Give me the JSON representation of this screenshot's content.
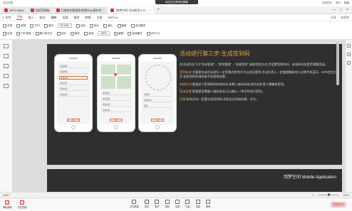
{
  "meeting": {
    "banner": "你正在共享你的屏幕",
    "top_left": "会议详情",
    "top_right": [
      "在线时长",
      "显示",
      "隐藏"
    ],
    "bottom_left": [
      {
        "label": "解除静音",
        "icon": "mic-off-icon"
      },
      {
        "label": "开启视频",
        "icon": "camera-off-icon"
      }
    ],
    "bottom_center": [
      {
        "label": "共享屏幕",
        "icon": "screen-share-icon"
      },
      {
        "label": "成员",
        "icon": "members-icon"
      },
      {
        "label": "聊天",
        "icon": "chat-icon"
      },
      {
        "label": "录制",
        "icon": "record-icon"
      },
      {
        "label": "应用",
        "icon": "apps-icon"
      },
      {
        "label": "白板",
        "icon": "whiteboard-icon"
      },
      {
        "label": "设置",
        "icon": "settings-icon"
      },
      {
        "label": "更多",
        "icon": "more-icon"
      }
    ],
    "end_label": "结束会议"
  },
  "tabs": [
    {
      "label": "WPS Office",
      "color": "#d9342b",
      "active": false
    },
    {
      "label": "找稻壳模板",
      "color": "#d9342b",
      "active": false
    },
    {
      "label": "行政机构管理系统操作(0)周补充...",
      "color": "#d9342b",
      "active": false
    },
    {
      "label": "\"到梦空间\"活动签到入口...",
      "color": "#d9342b",
      "active": true
    }
  ],
  "menu": {
    "file": "≡ 文件",
    "items": [
      "开始",
      "插入",
      "批注",
      "编辑",
      "页面",
      "保护",
      "转换",
      "工具",
      "WPS AI"
    ],
    "active_index": 0,
    "right": [
      "分享",
      "未同步"
    ]
  },
  "toolbar": {
    "row1": [
      "手型",
      "选择",
      "打印",
      "查找",
      "适合",
      "放大",
      "缩小",
      "旋转",
      "全文翻译"
    ],
    "row2": [
      "目录",
      "PDF转换",
      "图片转文字",
      "双页",
      "单页",
      "连续",
      "截图",
      "阅读模式",
      "WPS AI"
    ],
    "zoom": "80.44%",
    "page": "18/37"
  },
  "slide": {
    "title": "活动进行第三步:生成签到码",
    "intro": "在活动后台下方\"活动管理\"→\"签到管理\"→\"创建签到\",选取签到方式,并设置签到时间、有效时间及是否需要签退。",
    "bullets": [
      {
        "head": "签到有效:",
        "text": "主要是在该活动进行一定范围内签到才可以成功签到,活动负责人一定要提醒参加人员将手机蓝牙、GPS定位打开,若签到失败请检查手机权限设置。"
      },
      {
        "head": "有效时间:",
        "text": "是指这个签到码的有效时间,如果二维码失效,则活动负责人需重新签到。"
      },
      {
        "head": "签退设置:",
        "text": "是指是否需要二维码签退,可以输入一串字符进行签到。"
      }
    ],
    "note_head": "注意:",
    "note": "所有活动一定要生成签到码,否则无法添加成绩、学分。",
    "footer_brand": "到梦空间 Mobile Application"
  },
  "phones": {
    "p1_rows": [
      "活动管理",
      "签到管理",
      "创建签到",
      "签到方式",
      "签到时间",
      "有效时间"
    ],
    "p1_button": "确定",
    "p2_rows": [
      "签到地点",
      "签到范围",
      "签到时间",
      "有效时间"
    ],
    "p2_button": "确定",
    "p3_rows": [
      "签到码",
      "有效时间",
      "签退"
    ],
    "p3_button": "保存"
  },
  "status": {
    "left": "18/37",
    "right": [
      "100%"
    ]
  }
}
